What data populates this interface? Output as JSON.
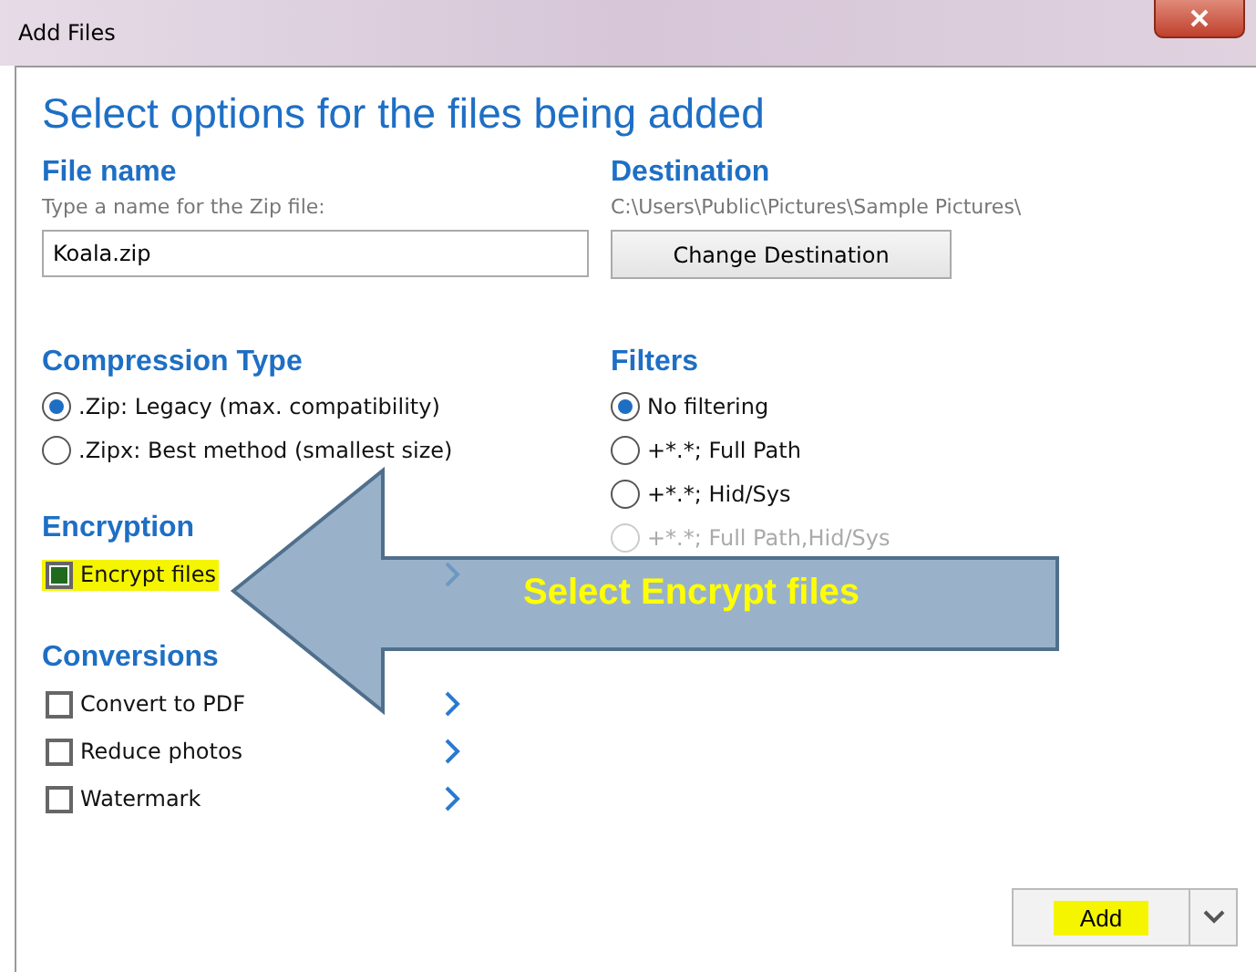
{
  "window": {
    "title": "Add Files"
  },
  "heading": "Select options for the files being added",
  "file_name": {
    "title": "File name",
    "hint": "Type a name for the Zip file:",
    "value": "Koala.zip"
  },
  "destination": {
    "title": "Destination",
    "path": "C:\\Users\\Public\\Pictures\\Sample Pictures\\",
    "button": "Change Destination"
  },
  "compression": {
    "title": "Compression Type",
    "options": [
      {
        "label": ".Zip: Legacy (max. compatibility)",
        "selected": true
      },
      {
        "label": ".Zipx: Best method (smallest size)",
        "selected": false
      }
    ]
  },
  "filters": {
    "title": "Filters",
    "options": [
      {
        "label": "No filtering",
        "selected": true,
        "disabled": false
      },
      {
        "label": "+*.*; Full Path",
        "selected": false,
        "disabled": false
      },
      {
        "label": "+*.*; Hid/Sys",
        "selected": false,
        "disabled": false
      },
      {
        "label": "+*.*; Full Path,Hid/Sys",
        "selected": false,
        "disabled": true
      }
    ]
  },
  "encryption": {
    "title": "Encryption",
    "items": [
      {
        "label": "Encrypt files",
        "checked": true,
        "highlighted": true
      }
    ]
  },
  "conversions": {
    "title": "Conversions",
    "items": [
      {
        "label": "Convert to PDF",
        "checked": false,
        "highlighted": false
      },
      {
        "label": "Reduce photos",
        "checked": false,
        "highlighted": false
      },
      {
        "label": "Watermark",
        "checked": false,
        "highlighted": false
      }
    ]
  },
  "callout": {
    "text": "Select Encrypt files"
  },
  "add_button": {
    "label": "Add",
    "highlighted": true
  }
}
